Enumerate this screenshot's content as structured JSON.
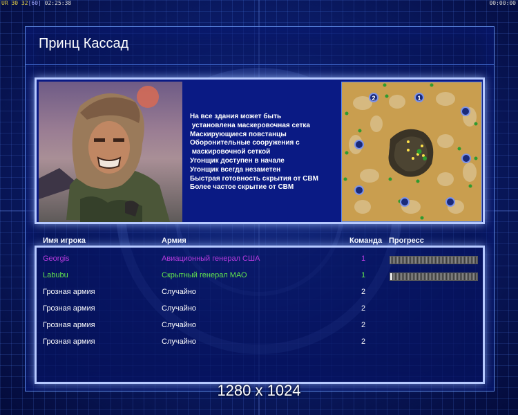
{
  "overlay": {
    "left_parts": [
      "UR",
      "30",
      "32",
      "[60]",
      "02:25:38"
    ],
    "right_text": "00:00:00"
  },
  "general": {
    "name": "Принц Кассад",
    "features": [
      "На все здания может быть",
      " установлена маскеровочная сетка",
      "Маскирующиеся повстанцы",
      "Оборонительные сооружения с",
      " маскировочной сеткой",
      "Угонщик доступен в начале",
      "Угонщик всегда незаметен",
      "Быстрая готовность скрытия от СВМ",
      "Более частое скрытие от СВМ"
    ],
    "map_labels": [
      "2",
      "1"
    ]
  },
  "table": {
    "headers": {
      "player": "Имя игрока",
      "army": "Армия",
      "team": "Команда",
      "progress": "Прогресс"
    },
    "rows": [
      {
        "name": "Georgis",
        "army": "Авиационный генерал США",
        "team": "1",
        "color": "#b93be0",
        "progress": 0.0
      },
      {
        "name": "Labubu",
        "army": "Скрытный генерал МАО",
        "team": "1",
        "color": "#63e84d",
        "progress": 0.02
      },
      {
        "name": "Грозная армия",
        "army": "Случайно",
        "team": "2",
        "color": "#ffffff"
      },
      {
        "name": "Грозная армия",
        "army": "Случайно",
        "team": "2",
        "color": "#ffffff"
      },
      {
        "name": "Грозная армия",
        "army": "Случайно",
        "team": "2",
        "color": "#ffffff"
      },
      {
        "name": "Грозная армия",
        "army": "Случайно",
        "team": "2",
        "color": "#ffffff"
      }
    ]
  },
  "resolution": "1280 x 1024"
}
